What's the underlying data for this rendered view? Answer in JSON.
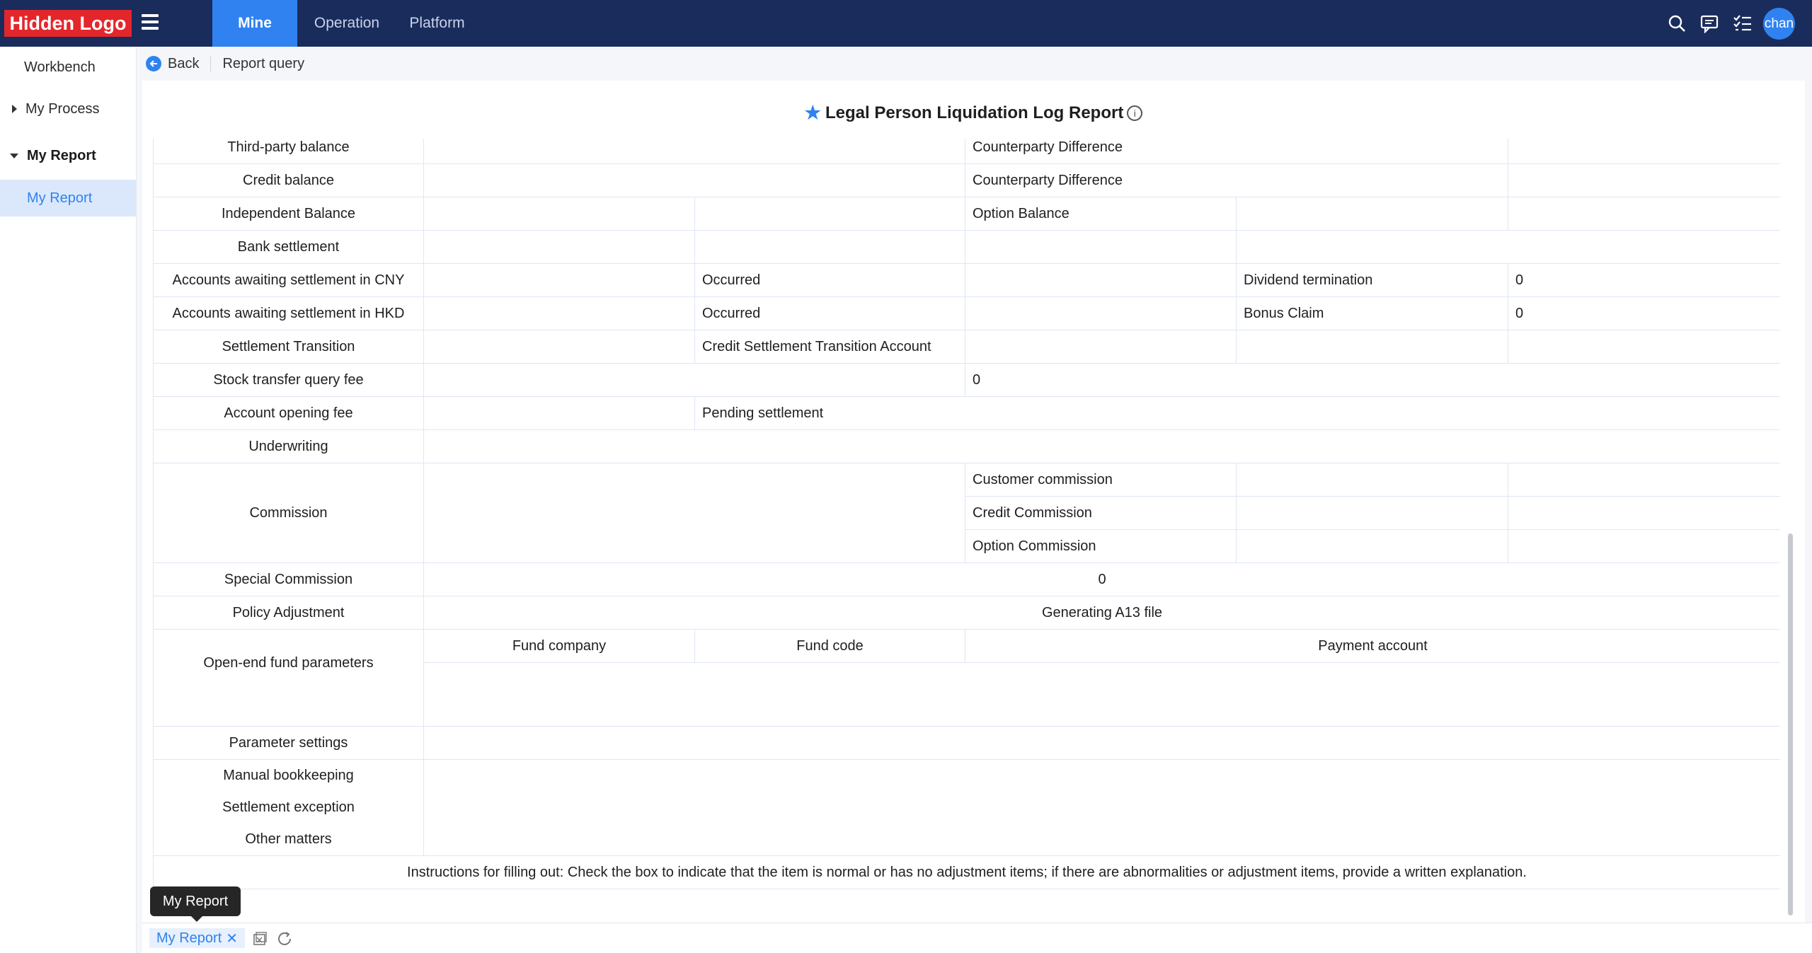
{
  "header": {
    "logo": "Hidden Logo",
    "tabs": [
      "Mine",
      "Operation",
      "Platform"
    ],
    "avatar": "chan"
  },
  "sidebar": {
    "items": [
      {
        "label": "Workbench"
      },
      {
        "label": "My Process"
      },
      {
        "label": "My Report"
      },
      {
        "label": "My Report"
      }
    ]
  },
  "breadcrumb": {
    "back": "Back",
    "current": "Report query"
  },
  "report": {
    "title": "Legal Person Liquidation Log Report",
    "rows": {
      "third_party": "Third-party balance",
      "counterparty_diff_top": "Counterparty Difference",
      "credit_balance": "Credit balance",
      "counterparty_diff": "Counterparty Difference",
      "independent_balance": "Independent Balance",
      "option_balance": "Option Balance",
      "bank_settlement": "Bank settlement",
      "cny": "Accounts awaiting settlement in CNY",
      "occurred1": "Occurred",
      "dividend": "Dividend termination",
      "dividend_val": "0",
      "hkd": "Accounts awaiting settlement in HKD",
      "occurred2": "Occurred",
      "bonus": "Bonus Claim",
      "bonus_val": "0",
      "settlement_transition": "Settlement Transition",
      "credit_transition": "Credit Settlement Transition Account",
      "stock_fee": "Stock transfer query fee",
      "stock_fee_val": "0",
      "opening_fee": "Account opening fee",
      "pending": "Pending settlement",
      "underwriting": "Underwriting",
      "commission": "Commission",
      "customer_commission": "Customer commission",
      "credit_commission": "Credit Commission",
      "option_commission": "Option Commission",
      "special_commission": "Special Commission",
      "special_val": "0",
      "policy": "Policy Adjustment",
      "a13": "Generating A13 file",
      "fund_company": "Fund company",
      "fund_code": "Fund code",
      "payment_account": "Payment account",
      "openend": "Open-end fund parameters",
      "param_settings": "Parameter settings",
      "manual": "Manual bookkeeping",
      "exception": "Settlement exception",
      "other": "Other matters",
      "instructions": "Instructions for filling out: Check the box to indicate that the item is normal or has no adjustment items; if there are abnormalities or adjustment items, provide a written explanation."
    }
  },
  "bottom": {
    "tab": "My Report",
    "tooltip": "My Report"
  }
}
